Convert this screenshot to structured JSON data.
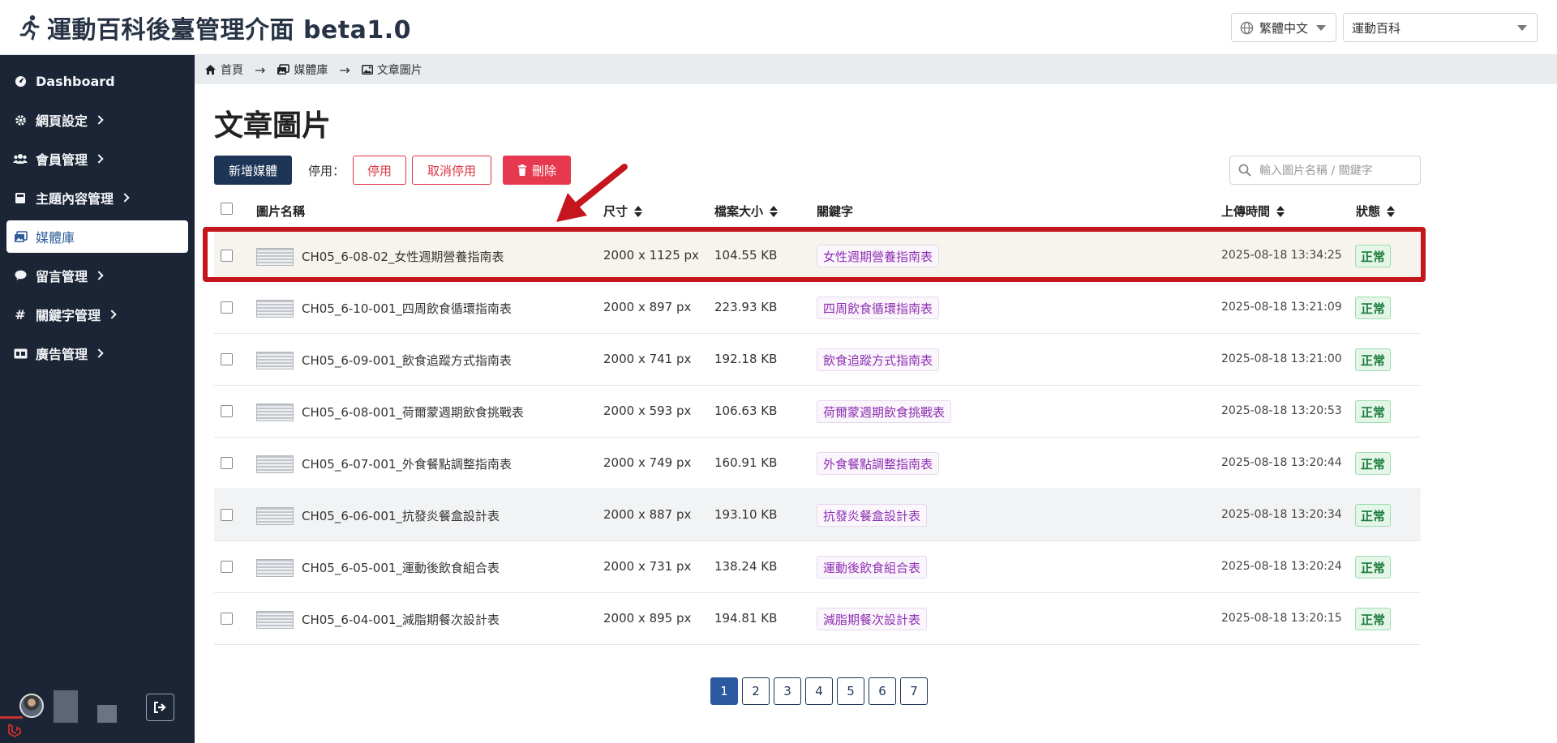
{
  "header": {
    "title": "運動百科後臺管理介面 beta1.0",
    "language": "繁體中文",
    "site": "運動百科"
  },
  "sidebar": {
    "items": [
      {
        "label": "Dashboard",
        "icon": "dashboard-icon",
        "has_submenu": false
      },
      {
        "label": "網頁設定",
        "icon": "gear-icon",
        "has_submenu": true
      },
      {
        "label": "會員管理",
        "icon": "users-icon",
        "has_submenu": true
      },
      {
        "label": "主題內容管理",
        "icon": "book-icon",
        "has_submenu": true
      },
      {
        "label": "媒體庫",
        "icon": "images-icon",
        "has_submenu": false,
        "active": true
      },
      {
        "label": "留言管理",
        "icon": "comment-icon",
        "has_submenu": true
      },
      {
        "label": "關鍵字管理",
        "icon": "hashtag-icon",
        "has_submenu": true
      },
      {
        "label": "廣告管理",
        "icon": "ad-icon",
        "has_submenu": true
      }
    ]
  },
  "breadcrumb": {
    "home": "首頁",
    "media": "媒體庫",
    "current": "文章圖片"
  },
  "page": {
    "title": "文章圖片",
    "add_button": "新增媒體",
    "disable_label": "停用：",
    "disable_button": "停用",
    "enable_button": "取消停用",
    "delete_button": "刪除",
    "search_placeholder": "輸入圖片名稱 / 關鍵字"
  },
  "table": {
    "columns": {
      "name": "圖片名稱",
      "size": "尺寸",
      "file_size": "檔案大小",
      "keyword": "關鍵字",
      "upload_time": "上傳時間",
      "status": "狀態"
    },
    "rows": [
      {
        "name": "CH05_6-08-02_女性週期營養指南表",
        "size": "2000 x 1125 px",
        "file_size": "104.55 KB",
        "keyword": "女性週期營養指南表",
        "time": "2025-08-18 13:34:25",
        "status": "正常"
      },
      {
        "name": "CH05_6-10-001_四周飲食循環指南表",
        "size": "2000 x 897 px",
        "file_size": "223.93 KB",
        "keyword": "四周飲食循環指南表",
        "time": "2025-08-18 13:21:09",
        "status": "正常"
      },
      {
        "name": "CH05_6-09-001_飲食追蹤方式指南表",
        "size": "2000 x 741 px",
        "file_size": "192.18 KB",
        "keyword": "飲食追蹤方式指南表",
        "time": "2025-08-18 13:21:00",
        "status": "正常"
      },
      {
        "name": "CH05_6-08-001_荷爾蒙週期飲食挑戰表",
        "size": "2000 x 593 px",
        "file_size": "106.63 KB",
        "keyword": "荷爾蒙週期飲食挑戰表",
        "time": "2025-08-18 13:20:53",
        "status": "正常"
      },
      {
        "name": "CH05_6-07-001_外食餐點調整指南表",
        "size": "2000 x 749 px",
        "file_size": "160.91 KB",
        "keyword": "外食餐點調整指南表",
        "time": "2025-08-18 13:20:44",
        "status": "正常"
      },
      {
        "name": "CH05_6-06-001_抗發炎餐盒設計表",
        "size": "2000 x 887 px",
        "file_size": "193.10 KB",
        "keyword": "抗發炎餐盒設計表",
        "time": "2025-08-18 13:20:34",
        "status": "正常"
      },
      {
        "name": "CH05_6-05-001_運動後飲食組合表",
        "size": "2000 x 731 px",
        "file_size": "138.24 KB",
        "keyword": "運動後飲食組合表",
        "time": "2025-08-18 13:20:24",
        "status": "正常"
      },
      {
        "name": "CH05_6-04-001_減脂期餐次設計表",
        "size": "2000 x 895 px",
        "file_size": "194.81 KB",
        "keyword": "減脂期餐次設計表",
        "time": "2025-08-18 13:20:15",
        "status": "正常"
      }
    ]
  },
  "pagination": {
    "pages": [
      "1",
      "2",
      "3",
      "4",
      "5",
      "6",
      "7"
    ],
    "current": "1"
  }
}
